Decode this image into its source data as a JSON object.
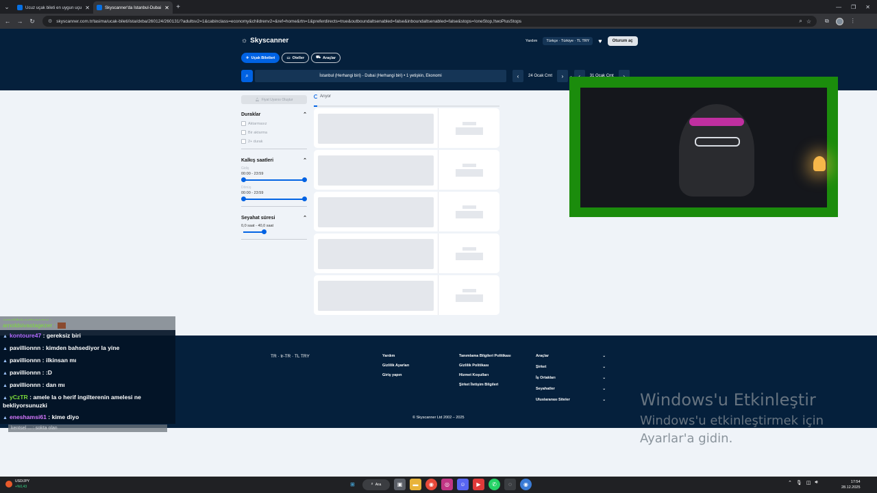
{
  "browser": {
    "tabs": [
      {
        "label": "Ucuz uçak bileti en uygun uçu",
        "active": false
      },
      {
        "label": "Skyscanner'da İstanbul-Dubai a",
        "active": true
      }
    ],
    "url": "skyscanner.com.tr/tasima/ucak-bileti/ista/dxba/260124/260131/?adultsv2=1&cabinclass=economy&childrenv2=&ref=home&rtn=1&preferdirects=true&outboundaltsenabled=false&inboundaltsenabled=false&stops=!oneStop,!twoPlusStops"
  },
  "header": {
    "logo": "Skyscanner",
    "help": "Yardım",
    "locale": "Türkçe · Türkiye · TL TRY",
    "login": "Oturum aç",
    "pills": [
      "Uçak Biletleri",
      "Oteller",
      "Araçlar"
    ],
    "search_summary": "İstanbul (Herhangi biri) - Dubai (Herhangi biri)  •  1 yetişkin, Ekonomi",
    "depart_date": "24 Ocak Cmt",
    "return_date": "31 Ocak Cmt"
  },
  "filters": {
    "price_alert": "Fiyat Uyarısı Oluştur",
    "stops_title": "Duraklar",
    "stops": [
      "Aktarmasız",
      "Bir aktarma",
      "2+ durak"
    ],
    "times_title": "Kalkış saatleri",
    "outbound_label": "Gidiş",
    "outbound_range": "00:00 - 23:59",
    "return_label": "Dönüş",
    "return_range": "00:00 - 23:59",
    "duration_title": "Seyahat süresi",
    "duration_range": "0,0 saat - 40,0 saat"
  },
  "results": {
    "status": "Arıyor",
    "progress": 0.02
  },
  "footer": {
    "locale": "TR · tr-TR · TL TRY",
    "col1": [
      "Yardım",
      "Gizlilik Ayarları",
      "Giriş yapın"
    ],
    "col2": [
      "Tanımlama Bilgileri Politikası",
      "Gizlilik Politikası",
      "Hizmet Koşulları",
      "Şirket İletişim Bilgileri"
    ],
    "col3": [
      "Araçlar",
      "Şirket",
      "İş Ortakları",
      "Seyahatler",
      "Uluslararası Siteler"
    ],
    "copyright": "© Skyscanner Ltd 2002 – 2025"
  },
  "watermark": {
    "line1": "Windows'u Etkinleştir",
    "line2": "Windows'u etkinleştirmek için",
    "line3": "Ayarlar'a gidin."
  },
  "chat": {
    "ghost_top": "arnoldsivastagezer :",
    "ghost_name": "arnoldsivastagezer :",
    "messages": [
      {
        "user": "kontoure47",
        "text": "gereksiz biri",
        "color": "#b46bff"
      },
      {
        "user": "pavillionnn",
        "text": "kimden bahsediyor la yine",
        "color": "#ffffff"
      },
      {
        "user": "pavillionnn",
        "text": "ilkinsan mı",
        "color": "#ffffff"
      },
      {
        "user": "pavillionnn",
        "text": ":D",
        "color": "#ffffff"
      },
      {
        "user": "pavillionnn",
        "text": "dan mı",
        "color": "#ffffff"
      },
      {
        "user": "yCzTR",
        "text": "amele la o herif ingilterenin amelesi ne bekliyorsunuzki",
        "color": "#7ddc3a"
      },
      {
        "user": "eneshamsi61",
        "text": "kime diyo",
        "color": "#d678ff"
      }
    ],
    "ghost_bottom": "kentsel ... : sokta olan"
  },
  "taskbar": {
    "ticker_symbol": "USD/JPY",
    "ticker_change": "+%0,43",
    "search": "Ara",
    "time": "17:54",
    "date": "28.12.2025"
  },
  "colors": {
    "brand_dark": "#05203c",
    "brand_blue": "#0062e3",
    "page_bg": "#eff3f8",
    "webcam_frame": "#1b8c0c"
  }
}
